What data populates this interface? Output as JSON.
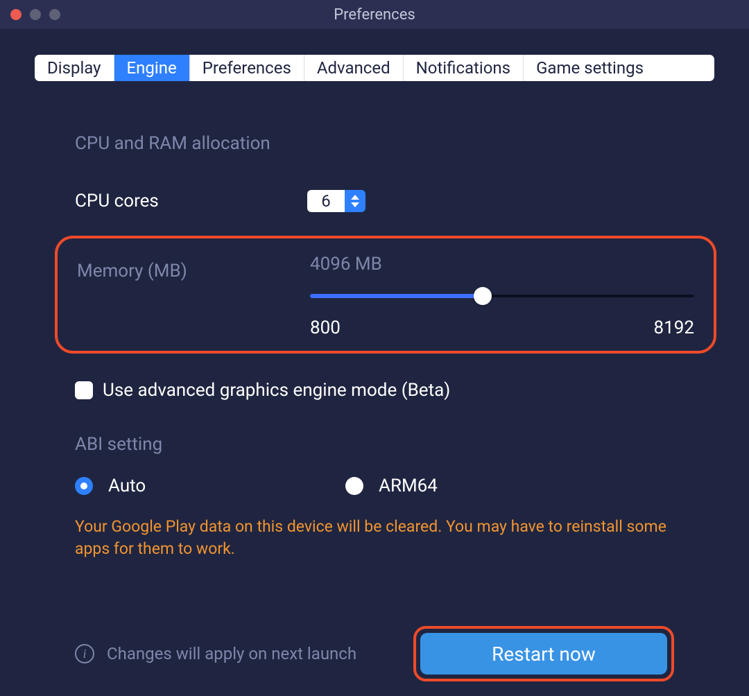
{
  "window": {
    "title": "Preferences"
  },
  "tabs": {
    "items": [
      {
        "label": "Display",
        "active": false
      },
      {
        "label": "Engine",
        "active": true
      },
      {
        "label": "Preferences",
        "active": false
      },
      {
        "label": "Advanced",
        "active": false
      },
      {
        "label": "Notifications",
        "active": false
      },
      {
        "label": "Game settings",
        "active": false
      }
    ]
  },
  "engine": {
    "section_title": "CPU and RAM allocation",
    "cpu": {
      "label": "CPU cores",
      "value": "6"
    },
    "memory": {
      "label": "Memory (MB)",
      "current_display": "4096 MB",
      "value": 4096,
      "min": "800",
      "max": "8192",
      "slider_percent": 45
    },
    "beta_checkbox": {
      "checked": false,
      "label": "Use advanced graphics engine mode (Beta)"
    },
    "abi": {
      "title": "ABI setting",
      "options": [
        {
          "label": "Auto",
          "selected": true
        },
        {
          "label": "ARM64",
          "selected": false
        }
      ],
      "warning": "Your Google Play data on this device will be cleared. You may have to reinstall some apps for them to work."
    },
    "footer": {
      "info_text": "Changes will apply on next launch",
      "restart_label": "Restart now"
    }
  }
}
